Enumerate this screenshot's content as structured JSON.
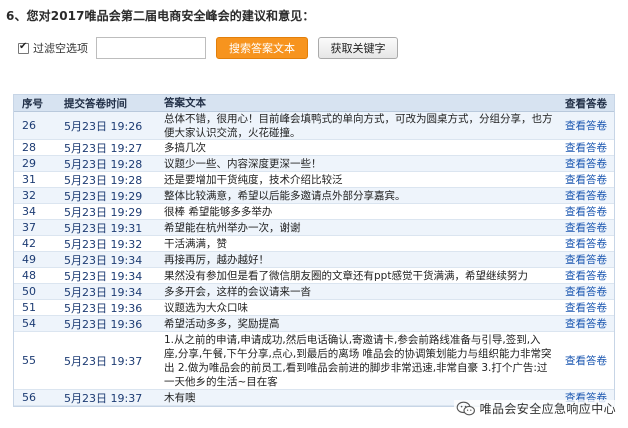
{
  "question": "6、您对2017唯品会第二届电商安全峰会的建议和意见：",
  "controls": {
    "filter_label": "过滤空选项",
    "search_placeholder": "",
    "search_button": "搜索答案文本",
    "keyword_button": "获取关键字"
  },
  "table": {
    "headers": {
      "no": "序号",
      "time": "提交答卷时间",
      "answer": "答案文本",
      "view": "查看答卷"
    },
    "rows": [
      {
        "no": "26",
        "time": "5月23日 19:26",
        "answer": "总体不错，很用心！目前峰会填鸭式的单向方式，可改为圆桌方式，分组分享，也方便大家认识交流，火花碰撞。",
        "view": "查看答卷"
      },
      {
        "no": "28",
        "time": "5月23日 19:27",
        "answer": "多搞几次",
        "view": "查看答卷"
      },
      {
        "no": "29",
        "time": "5月23日 19:28",
        "answer": "议题少一些、内容深度更深一些！",
        "view": "查看答卷"
      },
      {
        "no": "31",
        "time": "5月23日 19:28",
        "answer": "还是要增加干货纯度，技术介绍比较泛",
        "view": "查看答卷"
      },
      {
        "no": "32",
        "time": "5月23日 19:29",
        "answer": "整体比较满意，希望以后能多邀请点外部分享嘉宾。",
        "view": "查看答卷"
      },
      {
        "no": "34",
        "time": "5月23日 19:29",
        "answer": "很棒 希望能够多多举办",
        "view": "查看答卷"
      },
      {
        "no": "37",
        "time": "5月23日 19:31",
        "answer": "希望能在杭州举办一次，谢谢",
        "view": "查看答卷"
      },
      {
        "no": "42",
        "time": "5月23日 19:32",
        "answer": "干活满满，赞",
        "view": "查看答卷"
      },
      {
        "no": "49",
        "time": "5月23日 19:34",
        "answer": "再接再厉，越办越好！",
        "view": "查看答卷"
      },
      {
        "no": "48",
        "time": "5月23日 19:34",
        "answer": "果然没有参加但是看了微信朋友圈的文章还有ppt感觉干货满满，希望继续努力",
        "view": "查看答卷"
      },
      {
        "no": "50",
        "time": "5月23日 19:34",
        "answer": "多多开会，这样的会议请来一沓",
        "view": "查看答卷"
      },
      {
        "no": "51",
        "time": "5月23日 19:36",
        "answer": "议题选为大众口味",
        "view": "查看答卷"
      },
      {
        "no": "54",
        "time": "5月23日 19:36",
        "answer": "希望活动多多，奖励提高",
        "view": "查看答卷"
      },
      {
        "no": "55",
        "time": "5月23日 19:37",
        "answer": "1.从之前的申请,申请成功,然后电话确认,寄邀请卡,参会前路线准备与引导,签到,入座,分享,午餐,下午分享,点心,到最后的离场 唯品会的协调策划能力与组织能力非常突出 2.做为唯品会的前员工,看到唯品会前进的脚步非常迅速,非常自豪 3.打个广告:过一天他乡的生活~目在客",
        "view": "查看答卷"
      },
      {
        "no": "56",
        "time": "5月23日 19:37",
        "answer": "木有噢",
        "view": "查看答卷"
      }
    ]
  },
  "watermark": {
    "text": "唯品会安全应急响应中心",
    "icon": "wechat-icon"
  },
  "colors": {
    "accent_orange": "#f7941e",
    "header_bg": "#d7e3f1",
    "link_blue": "#1a56b0"
  }
}
